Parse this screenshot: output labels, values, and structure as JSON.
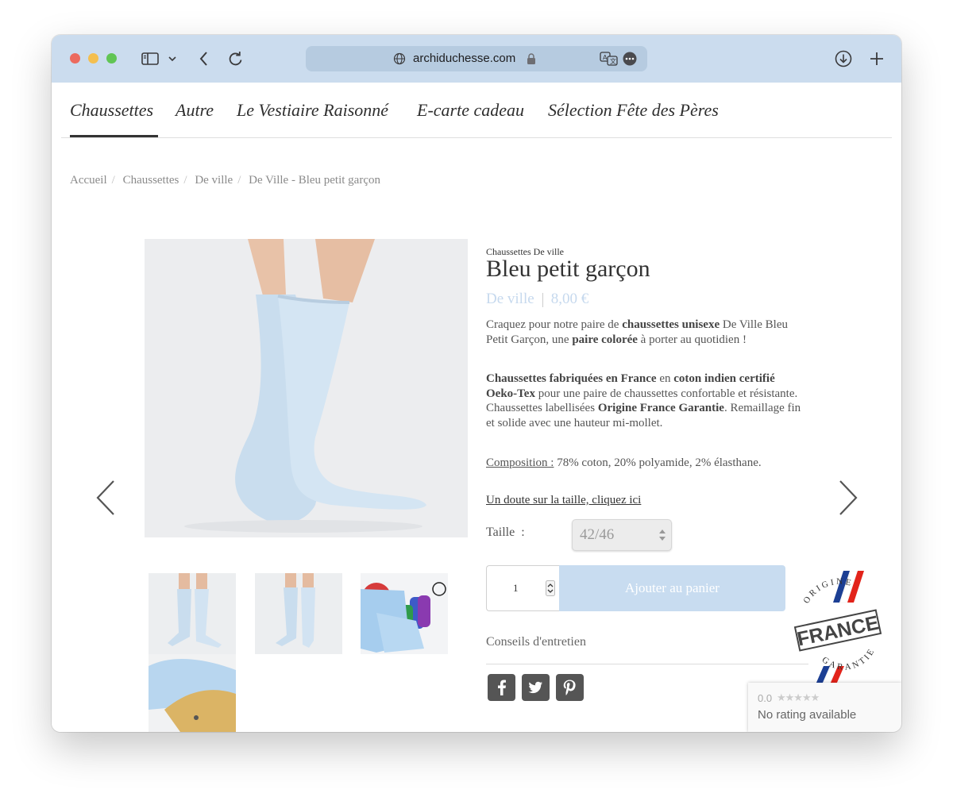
{
  "browser": {
    "url": "archiduchesse.com"
  },
  "nav": {
    "items": [
      {
        "label": "Chaussettes"
      },
      {
        "label": "Autre"
      },
      {
        "label": "Le Vestiaire Raisonné"
      },
      {
        "label": "E-carte cadeau"
      },
      {
        "label": "Sélection Fête des Pères"
      }
    ]
  },
  "breadcrumb": [
    "Accueil",
    "Chaussettes",
    "De ville",
    "De Ville - Bleu petit garçon"
  ],
  "product": {
    "category_line": "Chaussettes De ville",
    "title": "Bleu petit garçon",
    "collection": "De ville",
    "price": "8,00 €",
    "desc1": {
      "a": "Craquez pour notre paire de ",
      "b": "chaussettes unisexe",
      "c": " De Ville Bleu Petit Garçon, une ",
      "d": "paire colorée",
      "e": " à porter au quotidien !"
    },
    "desc2": {
      "a": "Chaussettes fabriquées en France",
      "b": " en ",
      "c": "coton indien certifié Oeko-Tex",
      "d": " pour une paire de chaussettes confortable et résistante. Chaussettes labellisées ",
      "e": "Origine France Garantie",
      "f": ". Remaillage fin et solide avec une hauteur mi-mollet."
    },
    "composition_label": "Composition :",
    "composition_value": " 78% coton, 20% polyamide, 2% élasthane.",
    "size_link": "Un doute sur la taille, cliquez ici",
    "size_label": "Taille  :",
    "size_value": "42/46",
    "quantity": "1",
    "add_to_cart": "Ajouter au panier",
    "care": "Conseils d'entretien"
  },
  "badge": {
    "top": "ORIGINE",
    "middle": "FRANCE",
    "bottom": "GARANTIE"
  },
  "rating": {
    "score": "0.0",
    "stars": "★★★★★",
    "text": "No rating available"
  },
  "colors": {
    "toolbar": "#cbdcee",
    "accent_light_blue": "#c8dcf0",
    "sock_blue": "#c9deef"
  },
  "icons": [
    "sidebar-icon",
    "chevron-down-icon",
    "back-icon",
    "reload-icon",
    "globe-icon",
    "lock-icon",
    "translate-icon",
    "more-icon",
    "download-icon",
    "plus-icon",
    "facebook-icon",
    "twitter-icon",
    "pinterest-icon"
  ]
}
